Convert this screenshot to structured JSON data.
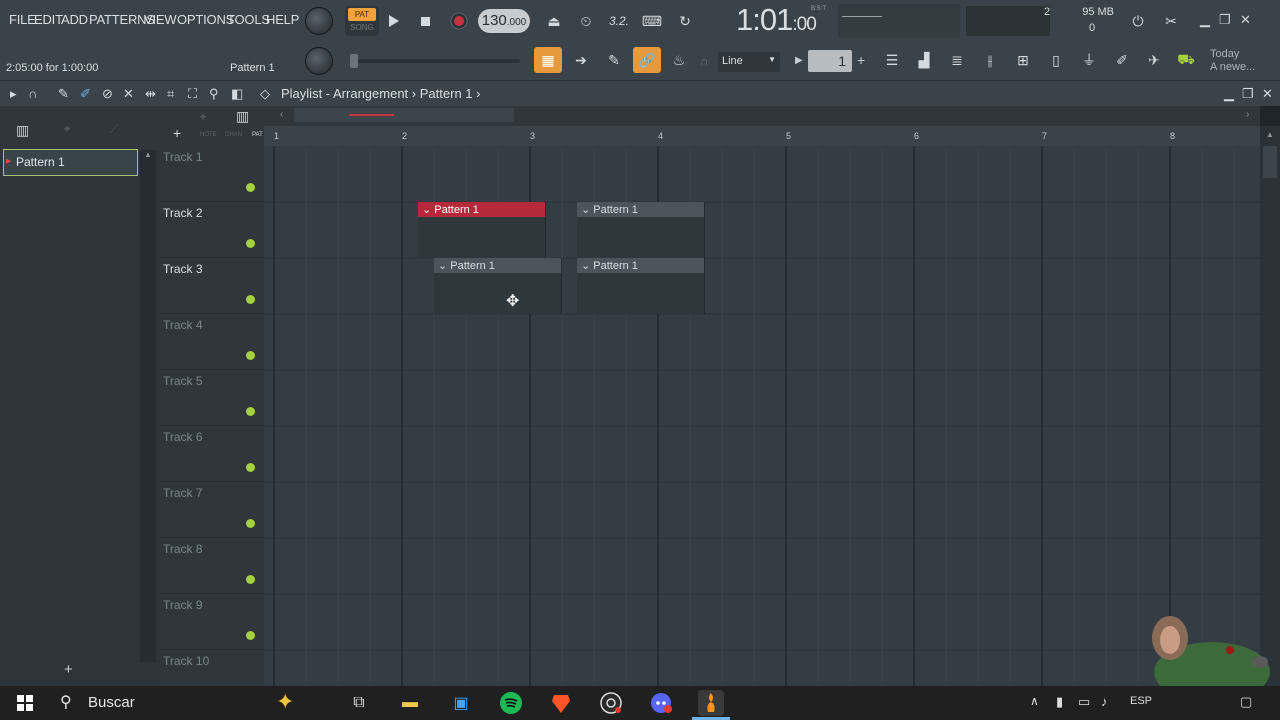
{
  "menu": {
    "items": [
      "FILE",
      "EDIT",
      "ADD",
      "PATTERNS",
      "VIEW",
      "OPTIONS",
      "TOOLS",
      "HELP"
    ]
  },
  "hint_bar": {
    "text": "2:05:00 for 1:00:00",
    "pattern": "Pattern 1"
  },
  "transport": {
    "pat_label": "PAT",
    "song_label": "SONG",
    "tempo": "130",
    "tempo_decimal": ".000"
  },
  "clock": {
    "time": "1:01",
    "ticks": ":00",
    "unit": "B:S:T"
  },
  "monitor": {
    "voices": "2",
    "memory": "95 MB",
    "cpu": "0"
  },
  "toolbar2": {
    "snap": "Line",
    "step": "1"
  },
  "news": {
    "line1": "Today",
    "line2": "A newe..."
  },
  "playlist": {
    "breadcrumb": [
      "Playlist - Arrangement",
      "Pattern 1"
    ],
    "picker_header": [
      "NOTE",
      "CHAN",
      "PAT"
    ],
    "browser_item": "Pattern 1",
    "ruler": [
      "1",
      "2",
      "3",
      "4",
      "5",
      "6",
      "7",
      "8"
    ],
    "tracks": [
      "Track 1",
      "Track 2",
      "Track 3",
      "Track 4",
      "Track 5",
      "Track 6",
      "Track 7",
      "Track 8",
      "Track 9",
      "Track 10"
    ],
    "clips": [
      {
        "label": "Pattern 1",
        "track": 2,
        "selected": true
      },
      {
        "label": "Pattern 1",
        "track": 2,
        "selected": false
      },
      {
        "label": "Pattern 1",
        "track": 3,
        "selected": false
      },
      {
        "label": "Pattern 1",
        "track": 3,
        "selected": false
      }
    ]
  },
  "taskbar": {
    "search": "Buscar",
    "lang": "ESP"
  },
  "colors": {
    "accent": "#e79a3c",
    "selected_clip": "#b52a3b",
    "track_dot": "#a7d13c",
    "browser_border": "#a9c36a"
  }
}
